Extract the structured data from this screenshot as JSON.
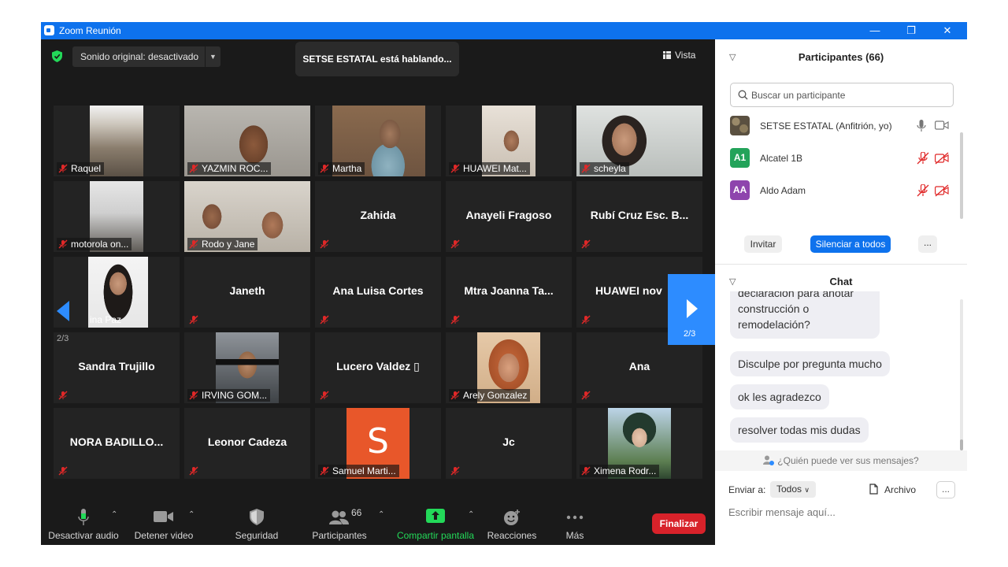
{
  "window": {
    "title": "Zoom Reunión"
  },
  "topbar": {
    "sound_label": "Sonido original: desactivado",
    "speaking": "SETSE ESTATAL está hablando...",
    "view_label": "Vista"
  },
  "tiles": [
    {
      "name": "Raquel",
      "type": "video"
    },
    {
      "name": "YAZMIN ROC...",
      "type": "video"
    },
    {
      "name": "Martha",
      "type": "video"
    },
    {
      "name": "HUAWEI Mat...",
      "type": "video"
    },
    {
      "name": "scheyla",
      "type": "video"
    },
    {
      "name": "motorola on...",
      "type": "video"
    },
    {
      "name": "Rodo y Jane",
      "type": "video"
    },
    {
      "name": "Zahida",
      "type": "name"
    },
    {
      "name": "Anayeli Fragoso",
      "type": "name"
    },
    {
      "name": "Rubí Cruz Esc. B...",
      "type": "name"
    },
    {
      "name": "ina Paz",
      "type": "video"
    },
    {
      "name": "Janeth",
      "type": "name"
    },
    {
      "name": "Ana Luisa Cortes",
      "type": "name"
    },
    {
      "name": "Mtra Joanna Ta...",
      "type": "name"
    },
    {
      "name": "HUAWEI nov",
      "type": "name"
    },
    {
      "name": "Sandra Trujillo",
      "type": "name"
    },
    {
      "name": "IRVING GOM...",
      "type": "video"
    },
    {
      "name": "Lucero  Valdez ▯",
      "type": "name"
    },
    {
      "name": "Arely Gonzalez",
      "type": "video"
    },
    {
      "name": "Ana",
      "type": "name"
    },
    {
      "name": "NORA BADILLO...",
      "type": "name"
    },
    {
      "name": "Leonor Cadeza",
      "type": "name"
    },
    {
      "name": "Samuel Marti...",
      "type": "avatar",
      "initial": "S"
    },
    {
      "name": "Jc",
      "type": "name"
    },
    {
      "name": "Ximena Rodr...",
      "type": "video"
    }
  ],
  "pagination": {
    "prev_page": "2/3",
    "next_page": "2/3"
  },
  "toolbar": {
    "mute": "Desactivar audio",
    "video": "Detener video",
    "security": "Seguridad",
    "participants": "Participantes",
    "participants_count": "66",
    "share": "Compartir pantalla",
    "reactions": "Reacciones",
    "more": "Más",
    "end": "Finalizar"
  },
  "participants_panel": {
    "title": "Participantes (66)",
    "search_placeholder": "Buscar un participante",
    "list": [
      {
        "name": "SETSE ESTATAL (Anfitrión, yo)",
        "initials": "",
        "color": "#5a5040"
      },
      {
        "name": "Alcatel 1B",
        "initials": "A1",
        "color": "#23a35a"
      },
      {
        "name": "Aldo Adam",
        "initials": "AA",
        "color": "#8e44ad"
      }
    ],
    "invite": "Invitar",
    "mute_all": "Silenciar a todos",
    "more": "..."
  },
  "chat": {
    "title": "Chat",
    "messages": [
      "declaración para anotar construcción o remodelación?",
      "Disculpe por pregunta mucho",
      "ok les agradezco",
      "resolver todas mis dudas"
    ],
    "who_sees": "¿Quién puede ver sus mensajes?",
    "send_to_label": "Enviar a:",
    "send_to_value": "Todos",
    "file_label": "Archivo",
    "more": "...",
    "input_placeholder": "Escribir mensaje aquí..."
  },
  "colors": {
    "title_bar": "#0e72ed",
    "accent": "#2d8cff",
    "end_button": "#d8222a",
    "mic_off": "#e02828",
    "share_green": "#23d959"
  }
}
